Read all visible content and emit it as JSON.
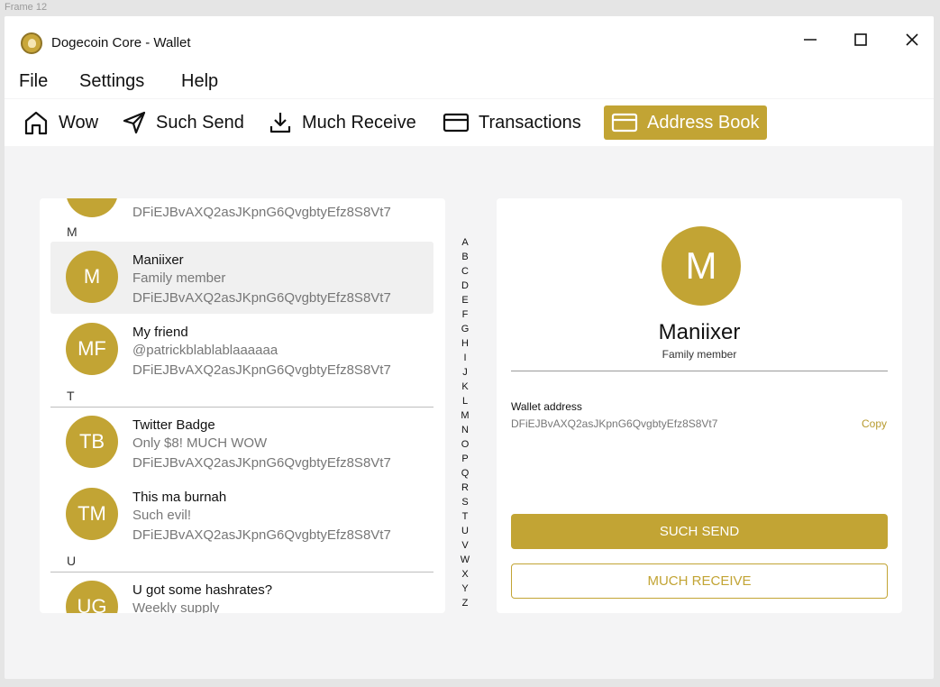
{
  "frame_label": "Frame 12",
  "app": {
    "title": "Dogecoin Core - Wallet"
  },
  "menu": [
    "File",
    "Settings",
    "Help"
  ],
  "toolbar": [
    {
      "label": "Wow",
      "icon": "home-icon"
    },
    {
      "label": "Such Send",
      "icon": "send-icon"
    },
    {
      "label": "Much Receive",
      "icon": "download-icon"
    },
    {
      "label": "Transactions",
      "icon": "card-icon"
    },
    {
      "label": "Address Book",
      "icon": "card-icon",
      "active": true
    }
  ],
  "sections": [
    "M",
    "T",
    "U"
  ],
  "contacts": [
    {
      "initials": "",
      "name": "",
      "sub": "",
      "address": "DFiEJBvAXQ2asJKpnG6QvgbtyEfz8S8Vt7"
    },
    {
      "initials": "M",
      "name": "Maniixer",
      "sub": "Family member",
      "address": "DFiEJBvAXQ2asJKpnG6QvgbtyEfz8S8Vt7",
      "selected": true
    },
    {
      "initials": "MF",
      "name": "My friend",
      "sub": "@patrickblablablaaaaaa",
      "address": "DFiEJBvAXQ2asJKpnG6QvgbtyEfz8S8Vt7"
    },
    {
      "initials": "TB",
      "name": "Twitter Badge",
      "sub": "Only $8! MUCH WOW",
      "address": "DFiEJBvAXQ2asJKpnG6QvgbtyEfz8S8Vt7"
    },
    {
      "initials": "TM",
      "name": "This ma burnah",
      "sub": "Such evil!",
      "address": "DFiEJBvAXQ2asJKpnG6QvgbtyEfz8S8Vt7"
    },
    {
      "initials": "UG",
      "name": "U got some hashrates?",
      "sub": "Weekly supply",
      "address": ""
    }
  ],
  "alphabet": [
    "A",
    "B",
    "C",
    "D",
    "E",
    "F",
    "G",
    "H",
    "I",
    "J",
    "K",
    "L",
    "M",
    "N",
    "O",
    "P",
    "Q",
    "R",
    "S",
    "T",
    "U",
    "V",
    "W",
    "X",
    "Y",
    "Z"
  ],
  "detail": {
    "initials": "M",
    "name": "Maniixer",
    "sub": "Family member",
    "wallet_label": "Wallet address",
    "wallet_address": "DFiEJBvAXQ2asJKpnG6QvgbtyEfz8S8Vt7",
    "copy_label": "Copy",
    "send_label": "SUCH SEND",
    "receive_label": "MUCH RECEIVE"
  },
  "colors": {
    "accent": "#c2a434",
    "panel": "#ffffff",
    "background": "#f4f4f5"
  }
}
